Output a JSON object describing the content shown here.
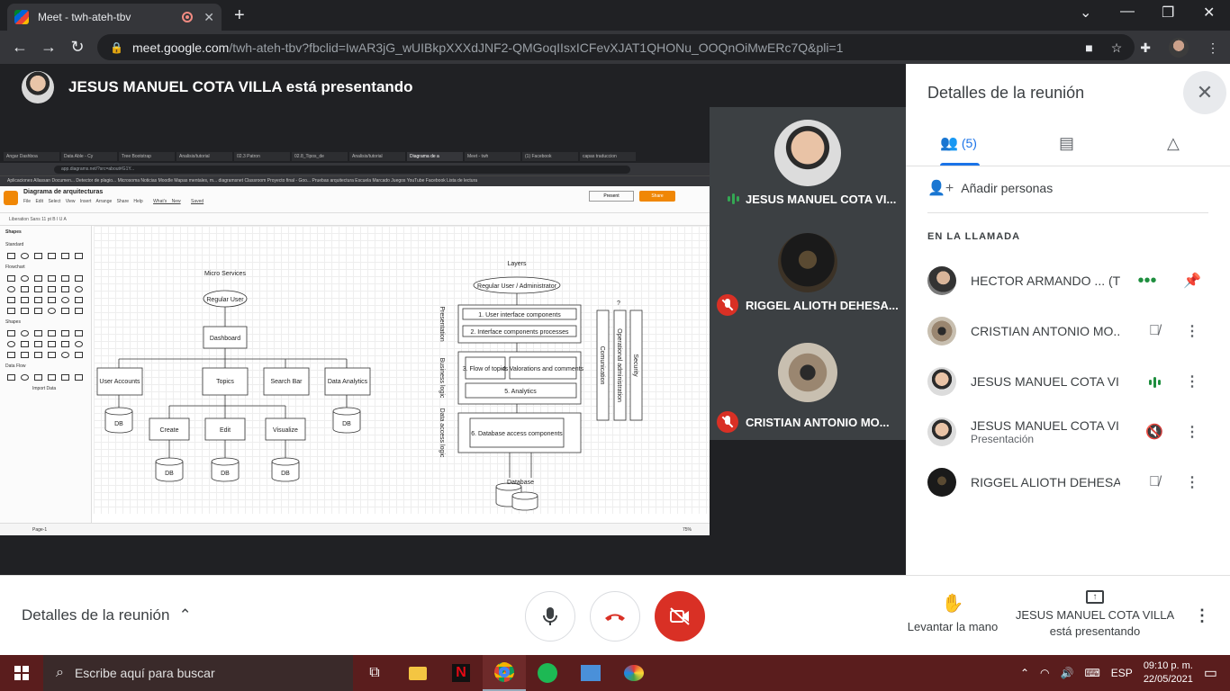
{
  "browser": {
    "tab_title": "Meet - twh-ateh-tbv",
    "url_host": "meet.google.com",
    "url_path": "/twh-ateh-tbv?fbclid=IwAR3jG_wUIBkpXXXdJNF2-QMGoqIIsxICFevXJAT1QHONu_OOQnOiMwERc7Q&pli=1"
  },
  "stage": {
    "presenter_text": "JESUS MANUEL COTA VILLA está presentando"
  },
  "shared_screen": {
    "tabs": [
      "Angar Dashboa",
      "Data Able - Cy",
      "Tree Bootstrap",
      "Analisis/tutorial",
      "02.3 Patron",
      "02.8_Tipos_de",
      "Analisis/tutorial",
      "Diagrama de a",
      "Meet - twh",
      "(1) Facebook",
      "capas traduccion"
    ],
    "active_tab_index": 7,
    "address": "app.diagrams.net/?src=about#G1Y...",
    "bookmarks": "Aplicaciones   Allassan Documen...   Detector de plagio...   Microsoma   Noticias   Moodle   Mapas mentales, m...   diagramsnet   Classroom   Proyecto final - Goo...   Pruebas arquitectura   Escuela   Marcado   Juegos   YouTube   Facebook   Lista de lectura",
    "doc_title": "Diagrama de arquitecturas",
    "menu": "File Edit Select View Insert Arrange Share Help",
    "whats_new": "What's New",
    "saved": "Saved",
    "present": "Present",
    "share": "Share",
    "toolbar_font": "Liberation Sans    11 pt    B  I  U  A",
    "shapes_label": "Shapes",
    "sec_standard": "Standard",
    "sec_flowchart": "Flowchart",
    "sec_shapes": "Shapes",
    "sec_dataflow": "Data Flow",
    "import_data": "Import Data",
    "page_label": "Page-1",
    "zoom": "75%",
    "diagram": {
      "micro_title": "Micro Services",
      "regular_user": "Regular User",
      "dashboard": "Dashboard",
      "user_accounts": "User Accounts",
      "topics": "Topics",
      "search_bar": "Search Bar",
      "data_analytics": "Data Analytics",
      "create": "Create",
      "edit": "Edit",
      "visualize": "Visualize",
      "db": "DB",
      "layers_title": "Layers",
      "regular_admin": "Regular User / Administrator",
      "presentation": "Presentation",
      "ui_components": "1. User interface components",
      "ui_processes": "2. Interface components processes",
      "business_logic": "Business logic",
      "flow_topics": "3. Flow of topics",
      "valorations": "4. Valorations and comments",
      "analytics": "5. Analytics",
      "data_access": "Data access logic",
      "db_access": "6. Database access components",
      "database": "Database",
      "communication": "Comunication",
      "operational": "Operational administration",
      "security": "Security",
      "question": "?"
    }
  },
  "tiles": [
    {
      "name": "JESUS MANUEL COTA VI...",
      "status": "speaking"
    },
    {
      "name": "RIGGEL ALIOTH DEHESA...",
      "status": "muted"
    },
    {
      "name": "CRISTIAN ANTONIO MO...",
      "status": "muted"
    }
  ],
  "panel": {
    "title": "Detalles de la reunión",
    "people_count": "(5)",
    "add_people": "Añadir personas",
    "section_label": "EN LA LLAMADA",
    "participants": [
      {
        "name": "HECTOR ARMANDO ... (Tú)",
        "sub": "",
        "icon": "dots"
      },
      {
        "name": "CRISTIAN ANTONIO MO...",
        "sub": "",
        "icon": "mic-off"
      },
      {
        "name": "JESUS MANUEL COTA VI...",
        "sub": "",
        "icon": "speaking"
      },
      {
        "name": "JESUS MANUEL COTA VI...",
        "sub": "Presentación",
        "icon": "volume-off"
      },
      {
        "name": "RIGGEL ALIOTH DEHESA...",
        "sub": "",
        "icon": "mic-off"
      }
    ]
  },
  "bottom": {
    "details": "Detalles de la reunión",
    "raise_hand": "Levantar la mano",
    "presenting_line1": "JESUS MANUEL COTA VILLA",
    "presenting_line2": "está presentando"
  },
  "taskbar": {
    "search_placeholder": "Escribe aquí para buscar",
    "language": "ESP",
    "time": "09:10 p. m.",
    "date": "22/05/2021"
  },
  "colors": {
    "meet_dark": "#202124",
    "tile_bg": "#3c4043",
    "accent_blue": "#1a73e8",
    "danger_red": "#d93025",
    "speaking_green": "#34a853",
    "taskbar": "#5a1d1d"
  }
}
